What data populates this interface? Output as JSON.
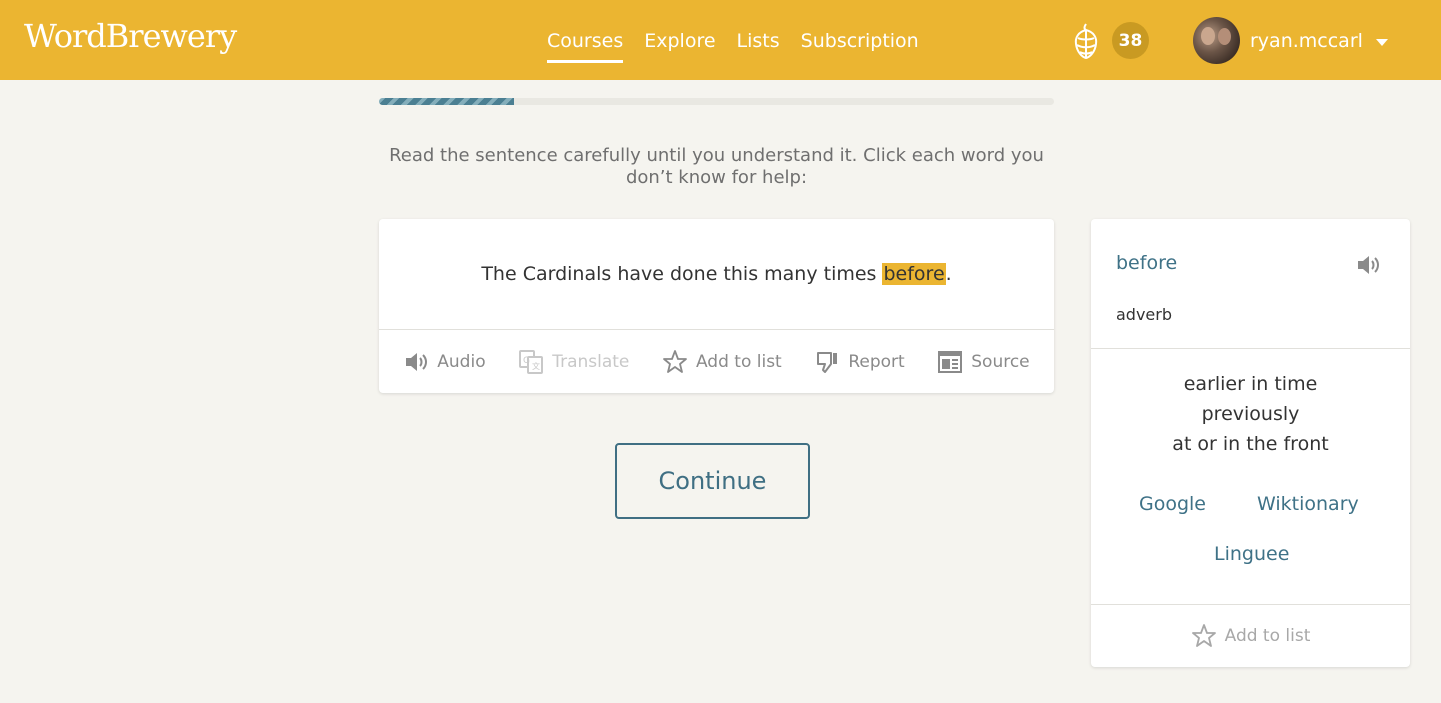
{
  "app": {
    "logo": "WordBrewery"
  },
  "nav": {
    "items": [
      {
        "label": "Courses",
        "active": true
      },
      {
        "label": "Explore",
        "active": false
      },
      {
        "label": "Lists",
        "active": false
      },
      {
        "label": "Subscription",
        "active": false
      }
    ]
  },
  "header": {
    "hops_count": "38",
    "username": "ryan.mccarl",
    "icons": [
      "hop-icon",
      "avatar",
      "chevron-down-icon"
    ]
  },
  "progress": {
    "value": 0.2
  },
  "instructions": "Read the sentence carefully until you understand it. Click each word you don’t know for help:",
  "sentence": {
    "before": "The Cardinals have done this many times ",
    "highlight": "before",
    "after": "."
  },
  "card_actions": [
    {
      "label": "Audio",
      "icon": "speaker-icon",
      "enabled": true
    },
    {
      "label": "Translate",
      "icon": "translate-icon",
      "enabled": false
    },
    {
      "label": "Add to list",
      "icon": "star-icon",
      "enabled": true
    },
    {
      "label": "Report",
      "icon": "thumbs-down-icon",
      "enabled": true
    },
    {
      "label": "Source",
      "icon": "source-icon",
      "enabled": true
    }
  ],
  "continue_label": "Continue",
  "panel": {
    "word": "before",
    "part_of_speech": "adverb",
    "definitions": [
      "earlier in time",
      "previously",
      "at or in the front"
    ],
    "links": [
      "Google",
      "Wiktionary",
      "Linguee"
    ],
    "add_to_list": "Add to list"
  },
  "colors": {
    "accent": "#ebb531",
    "link": "#3f7287",
    "background": "#f5f4ef"
  }
}
